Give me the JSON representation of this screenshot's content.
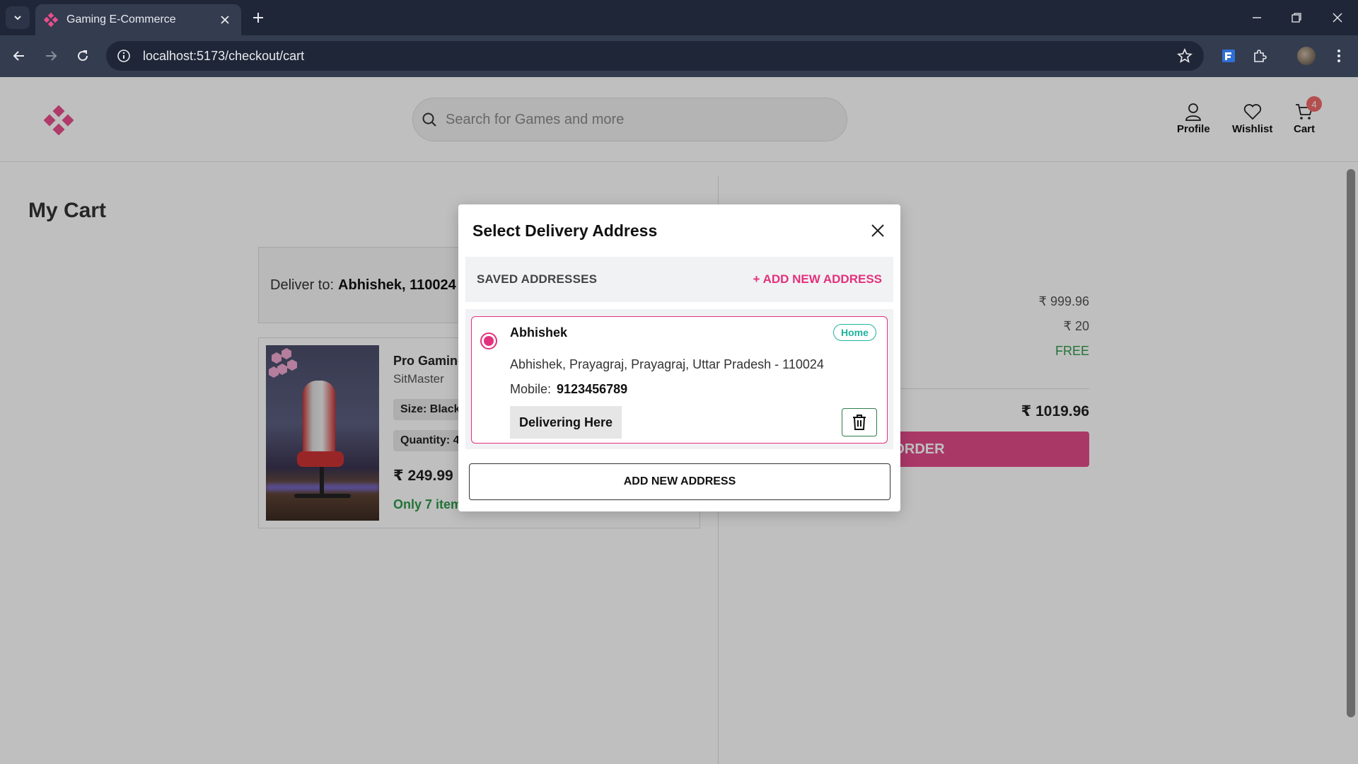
{
  "browser": {
    "tab_title": "Gaming E-Commerce",
    "url": "localhost:5173/checkout/cart"
  },
  "header": {
    "search_placeholder": "Search for Games and more",
    "profile_label": "Profile",
    "wishlist_label": "Wishlist",
    "cart_label": "Cart",
    "cart_count": "4"
  },
  "cart": {
    "title": "My Cart",
    "deliver_prefix": "Deliver to:",
    "deliver_value": "Abhishek, 110024",
    "item": {
      "name": "Pro Gaming",
      "brand": "SitMaster",
      "size": "Size: Black",
      "quantity": "Quantity: 4",
      "price": "₹ 249.99",
      "stock": "Only 7 item"
    },
    "summary": {
      "subtotal": "₹ 999.96",
      "tax": "₹ 20",
      "shipping": "FREE",
      "total": "₹ 1019.96",
      "place_order_label": "E ORDER"
    }
  },
  "modal": {
    "title": "Select Delivery Address",
    "saved_title": "SAVED ADDRESSES",
    "add_link": "+ ADD NEW ADDRESS",
    "address": {
      "name": "Abhishek",
      "tag": "Home",
      "line": "Abhishek, Prayagraj, Prayagraj, Uttar Pradesh - 110024",
      "mobile_label": "Mobile:",
      "mobile": "9123456789",
      "deliver_button": "Delivering Here"
    },
    "add_button": "ADD NEW ADDRESS"
  },
  "colors": {
    "accent": "#e3317d",
    "tag": "#20b39b",
    "stock": "#2e9a4a"
  }
}
